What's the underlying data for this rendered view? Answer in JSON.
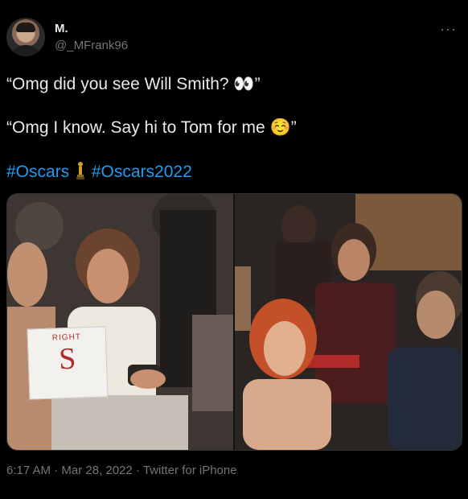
{
  "author": {
    "display_name": "M.",
    "handle": "@_MFrank96"
  },
  "tweet": {
    "line1": "“Omg did you see Will Smith? 👀”",
    "line2": "“Omg I know. Say hi to Tom for me ☺️”",
    "hashtag1": "#Oscars",
    "hashtag2": "#Oscars2022"
  },
  "media": {
    "sign_text": "RIGHT",
    "sign_letter": "S"
  },
  "meta": {
    "time": "6:17 AM",
    "date": "Mar 28, 2022",
    "source": "Twitter for iPhone"
  },
  "icons": {
    "more": "more-horizontal-icon",
    "oscar": "oscar-trophy-icon"
  },
  "colors": {
    "background": "#000000",
    "text": "#e7e9ea",
    "secondary": "#71767b",
    "hashtag": "#1d9bf0"
  }
}
